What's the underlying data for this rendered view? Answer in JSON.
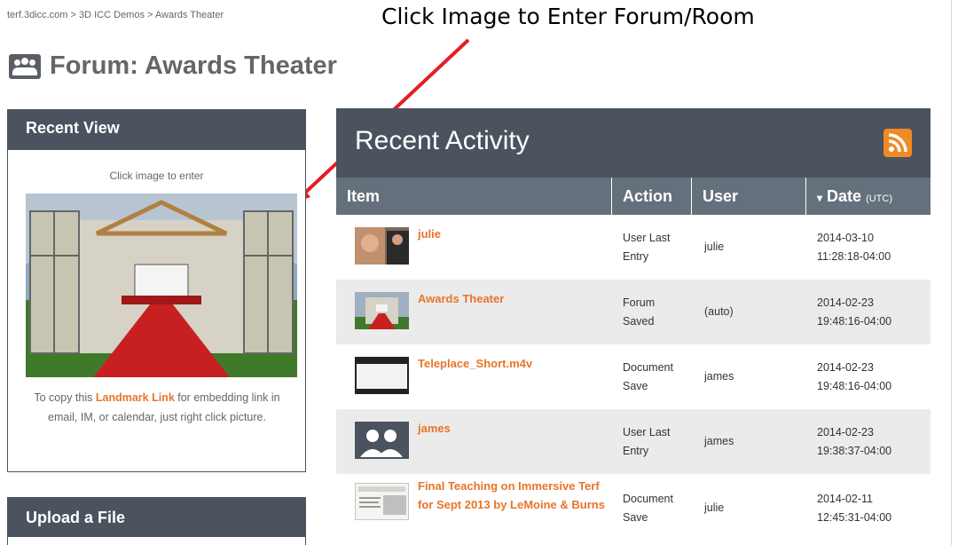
{
  "breadcrumb": "terf.3dicc.com > 3D ICC Demos > Awards Theater",
  "annotation": "Click Image to Enter Forum/Room",
  "page_title": "Forum: Awards Theater",
  "recent_view": {
    "heading": "Recent View",
    "caption": "Click image to enter",
    "note_before": "To copy this ",
    "note_link": "Landmark Link",
    "note_after": " for embedding link in email, IM, or calendar, just right click picture."
  },
  "upload": {
    "heading": "Upload a File"
  },
  "activity": {
    "title": "Recent Activity",
    "rss_icon": "rss-icon",
    "columns": {
      "item": "Item",
      "action": "Action",
      "user": "User",
      "date_arrow": "▾",
      "date": "Date",
      "date_unit": "(UTC)"
    },
    "rows": [
      {
        "item": "julie",
        "action_1": "User Last",
        "action_2": "Entry",
        "user": "julie",
        "date_1": "2014-03-10",
        "date_2": "11:28:18-04:00"
      },
      {
        "item": "Awards Theater",
        "action_1": "Forum",
        "action_2": "Saved",
        "user": "(auto)",
        "date_1": "2014-02-23",
        "date_2": "19:48:16-04:00"
      },
      {
        "item": "Teleplace_Short.m4v",
        "action_1": "Document",
        "action_2": "Save",
        "user": "james",
        "date_1": "2014-02-23",
        "date_2": "19:48:16-04:00"
      },
      {
        "item": "james",
        "action_1": "User Last",
        "action_2": "Entry",
        "user": "james",
        "date_1": "2014-02-23",
        "date_2": "19:38:37-04:00"
      },
      {
        "item": "Final Teaching on Immersive Terf for Sept 2013 by LeMoine & Burns",
        "action_1": "Document",
        "action_2": "Save",
        "user": "julie",
        "date_1": "2014-02-11",
        "date_2": "12:45:31-04:00"
      }
    ]
  },
  "colors": {
    "header": "#4a535e",
    "column_header": "#64707c",
    "accent": "#e8742a",
    "arrow": "#e31e24",
    "alt_row": "#ebebeb"
  }
}
